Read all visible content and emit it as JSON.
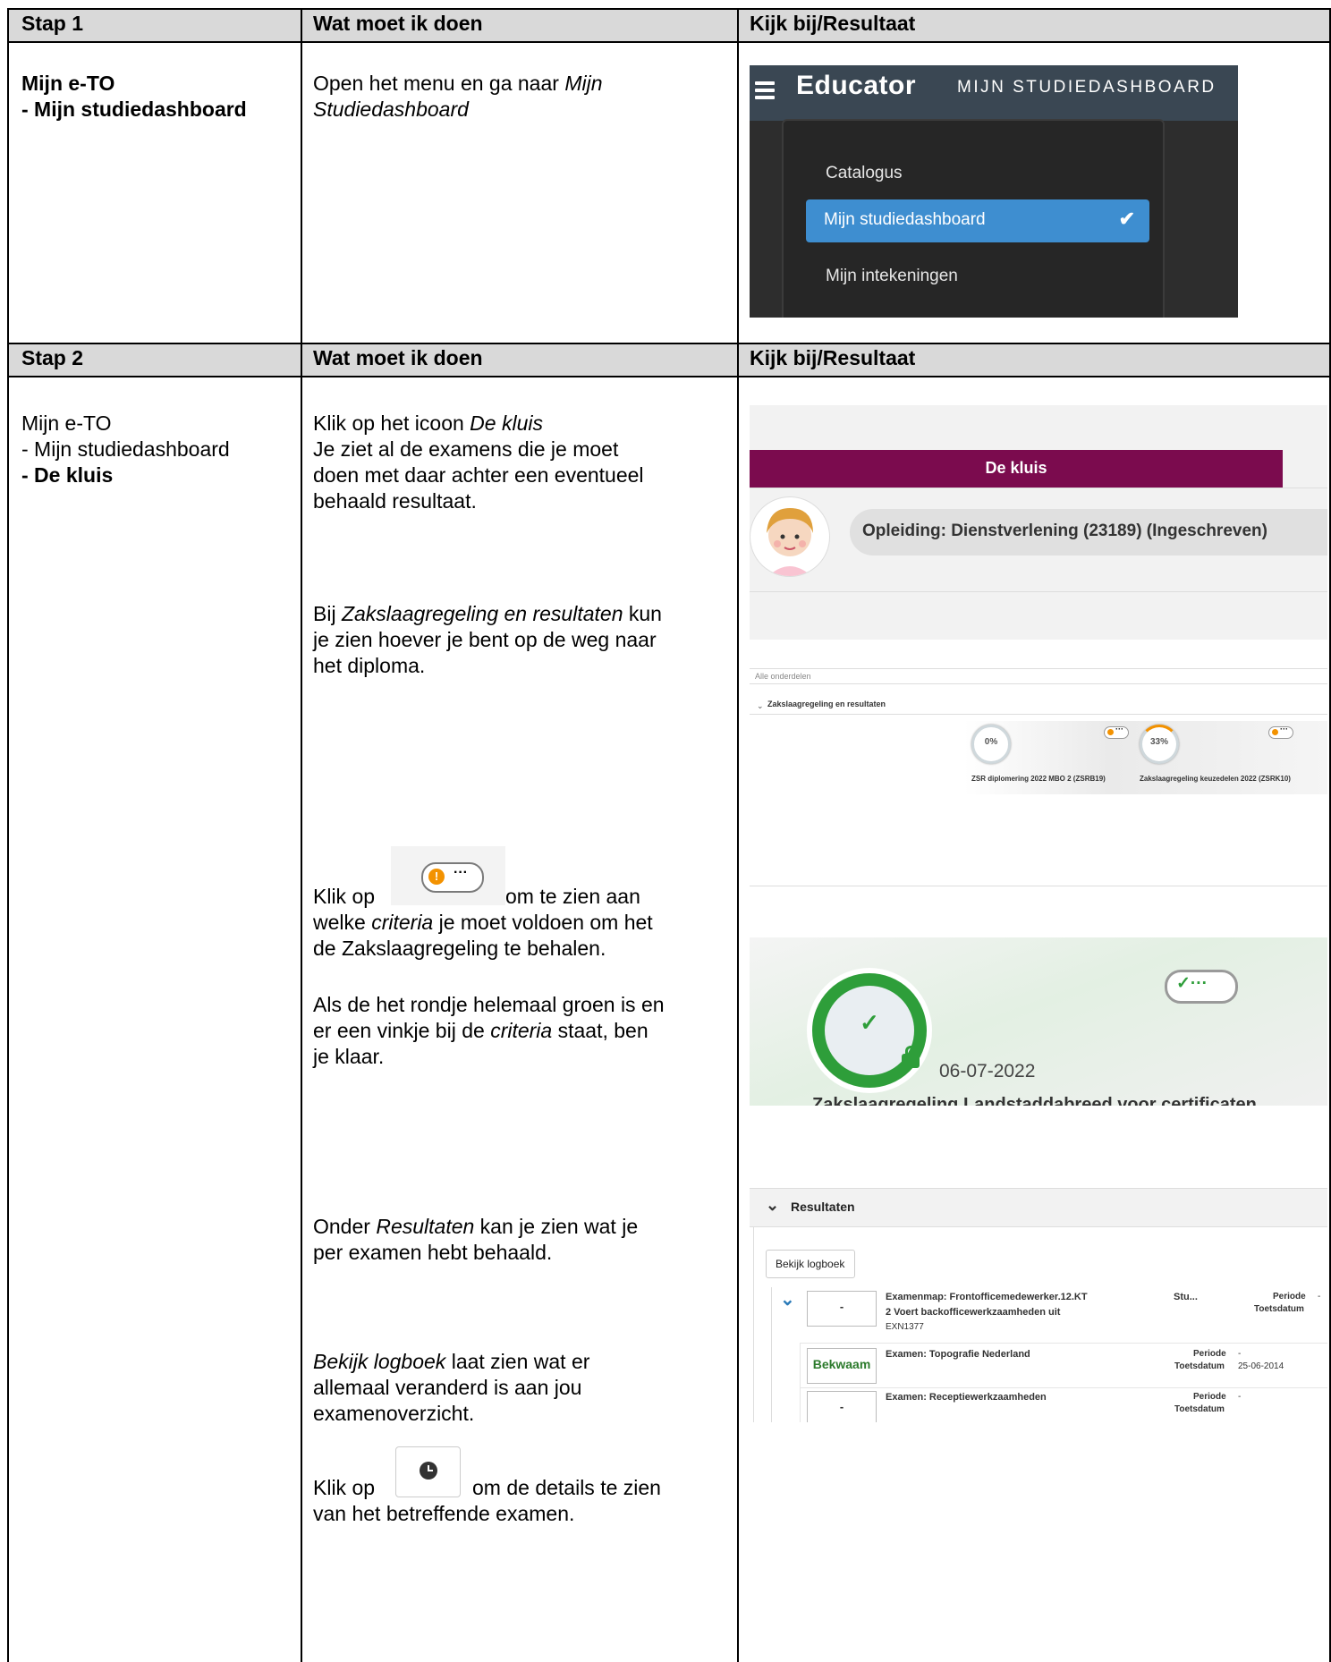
{
  "step1": {
    "header": {
      "col1": "Stap 1",
      "col2": "Wat moet ik doen",
      "col3": "Kijk bij/Resultaat"
    },
    "col1_lines": [
      "Mijn e-TO",
      "- Mijn studiedashboard"
    ],
    "col2_plain": "Open het menu en ga naar ",
    "col2_italic_1": "Mijn",
    "col2_italic_2": "Studiedashboard",
    "screenshot": {
      "logo": "Educator",
      "subtitle": "MIJN STUDIEDASHBOARD",
      "items": [
        "Catalogus",
        "Mijn studiedashboard",
        "Mijn intekeningen"
      ],
      "active_check": "✔"
    }
  },
  "step2": {
    "header": {
      "col1": "Stap 2",
      "col2": "Wat moet ik doen",
      "col3": "Kijk bij/Resultaat"
    },
    "col1_lines": [
      "Mijn e-TO",
      "- Mijn studiedashboard",
      "- De kluis"
    ],
    "p1": {
      "a": "Klik op het icoon ",
      "a_italic": "De kluis",
      "lines": [
        "Je ziet al de examens die je moet",
        "doen met daar achter een eventueel",
        "behaald resultaat."
      ]
    },
    "p2": {
      "a": "Bij ",
      "a_italic": "Zakslaagregeling en resultaten",
      "a_end": " kun",
      "lines": [
        "je zien hoever je bent op de weg naar",
        "het diploma."
      ]
    },
    "p3": {
      "klik": "Klik op",
      "after": "om te zien aan",
      "line2_a": "welke ",
      "line2_italic": "criteria",
      "line2_b": " je moet voldoen om het",
      "line3": "de Zakslaagregeling te behalen."
    },
    "p4": {
      "line1": "Als de het rondje helemaal groen is en",
      "line2_a": "er een vinkje bij de ",
      "line2_italic": "criteria",
      "line2_b": " staat, ben",
      "line3": "je klaar."
    },
    "p5": {
      "a": "Onder ",
      "a_italic": "Resultaten",
      "a_end": " kan je zien wat je",
      "line2": "per examen hebt behaald."
    },
    "p6": {
      "a_italic": "Bekijk logboek",
      "a_end": " laat zien wat er",
      "line2": "allemaal veranderd is aan jou",
      "line3": "examenoverzicht."
    },
    "p7": {
      "klik": "Klik op",
      "after": "om de details te zien",
      "line2": "van het betreffende examen."
    },
    "kluis": {
      "band": "De kluis",
      "opleiding": "Opleiding: Dienstverlening (23189) (Ingeschreven)"
    },
    "zak": {
      "filter": "Alle onderdelen",
      "section": "Zakslaagregeling en resultaten",
      "rings": [
        {
          "pct": "0%",
          "label": "ZSR diplomering 2022 MBO 2 (ZSRB19)"
        },
        {
          "pct": "33%",
          "label": "Zakslaagregeling keuzedelen 2022 (ZSRK10)"
        }
      ]
    },
    "green": {
      "date": "06-07-2022",
      "cut_title": "Zakslaagregeling Landstaddabreed voor certificaten"
    },
    "resultaten": {
      "title": "Resultaten",
      "logboek": "Bekijk logboek",
      "row1": {
        "box": "-",
        "title1": "Examenmap: Frontofficemedewerker.12.KT",
        "title2": "2 Voert backofficewerkzaamheden uit",
        "code": "EXN1377",
        "stu": "Stu...",
        "periode": "Periode",
        "dash": "-",
        "toets": "Toetsdatum"
      },
      "row2": {
        "box": "Bekwaam",
        "title": "Examen: Topografie Nederland",
        "periode": "Periode",
        "dash": "-",
        "toets": "Toetsdatum",
        "date": "25-06-2014"
      },
      "row3": {
        "box": "-",
        "title": "Examen: Receptiewerkzaamheden",
        "periode": "Periode",
        "dash": "-",
        "toets": "Toetsdatum"
      }
    }
  }
}
